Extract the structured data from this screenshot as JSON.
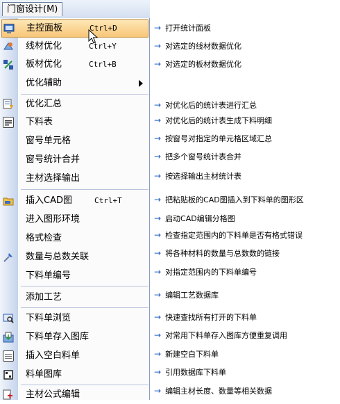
{
  "menubar": {
    "title": "门窗设计(M)"
  },
  "menu": {
    "items": [
      {
        "label": "主控面板",
        "shortcut": "Ctrl+D",
        "icon": "control-panel-icon",
        "selected": true
      },
      {
        "label": "线材优化",
        "shortcut": "Ctrl+Y",
        "icon": "line-optimize-icon"
      },
      {
        "label": "板材优化",
        "shortcut": "Ctrl+B",
        "icon": "board-optimize-icon"
      },
      {
        "label": "优化辅助",
        "shortcut": "",
        "submenu": true
      },
      {
        "label": "优化汇总",
        "shortcut": "",
        "icon": "summary-icon"
      },
      {
        "label": "下料表",
        "shortcut": "",
        "icon": "cutting-list-icon"
      },
      {
        "label": "窗号单元格",
        "shortcut": ""
      },
      {
        "label": "窗号统计合并",
        "shortcut": ""
      },
      {
        "label": "主材选择输出",
        "shortcut": ""
      },
      {
        "label": "插入CAD图",
        "shortcut": "Ctrl+T",
        "icon": "insert-cad-icon"
      },
      {
        "label": "进入图形环境",
        "shortcut": ""
      },
      {
        "label": "格式检查",
        "shortcut": ""
      },
      {
        "label": "数量与总数关联",
        "shortcut": "",
        "icon": "link-quantity-icon"
      },
      {
        "label": "下料单编号",
        "shortcut": ""
      },
      {
        "label": "添加工艺",
        "shortcut": ""
      },
      {
        "label": "下料单浏览",
        "shortcut": "",
        "icon": "browse-icon"
      },
      {
        "label": "下料单存入图库",
        "shortcut": "",
        "icon": "save-to-library-icon"
      },
      {
        "label": "插入空白料单",
        "shortcut": "",
        "icon": "blank-sheet-icon"
      },
      {
        "label": "料单图库",
        "shortcut": "",
        "icon": "sheet-library-icon"
      },
      {
        "label": "主材公式编辑",
        "shortcut": "",
        "icon": "formula-edit-icon"
      }
    ]
  },
  "descriptions": [
    "打开统计面板",
    "对选定的线材数据优化",
    "对选定的板材数据优化",
    "对优化后的统计表进行汇总",
    "对优化后的统计表生成下料明细",
    "按窗号对指定的单元格区域汇总",
    "把多个窗号统计表合并",
    "按选择输出主材统计表",
    "把粘贴板的CAD图插入到下料单的图形区",
    "启动CAD编辑分格图",
    "检查指定范围内的下料单是否有格式错误",
    "将各种材料的数量与总数数的链接",
    "对指定范围内的下料单编号",
    "编辑工艺数据库",
    "快速查找所有打开的下料单",
    "对常用下料单存入图库方便重复调用",
    "新建空白下料单",
    "引用数据库下料单",
    "编辑主材长度、数量等相关数据"
  ],
  "arrow_glyph": "→",
  "colors": {
    "accent": "#1f5fbf",
    "highlight": "#f8c679"
  }
}
